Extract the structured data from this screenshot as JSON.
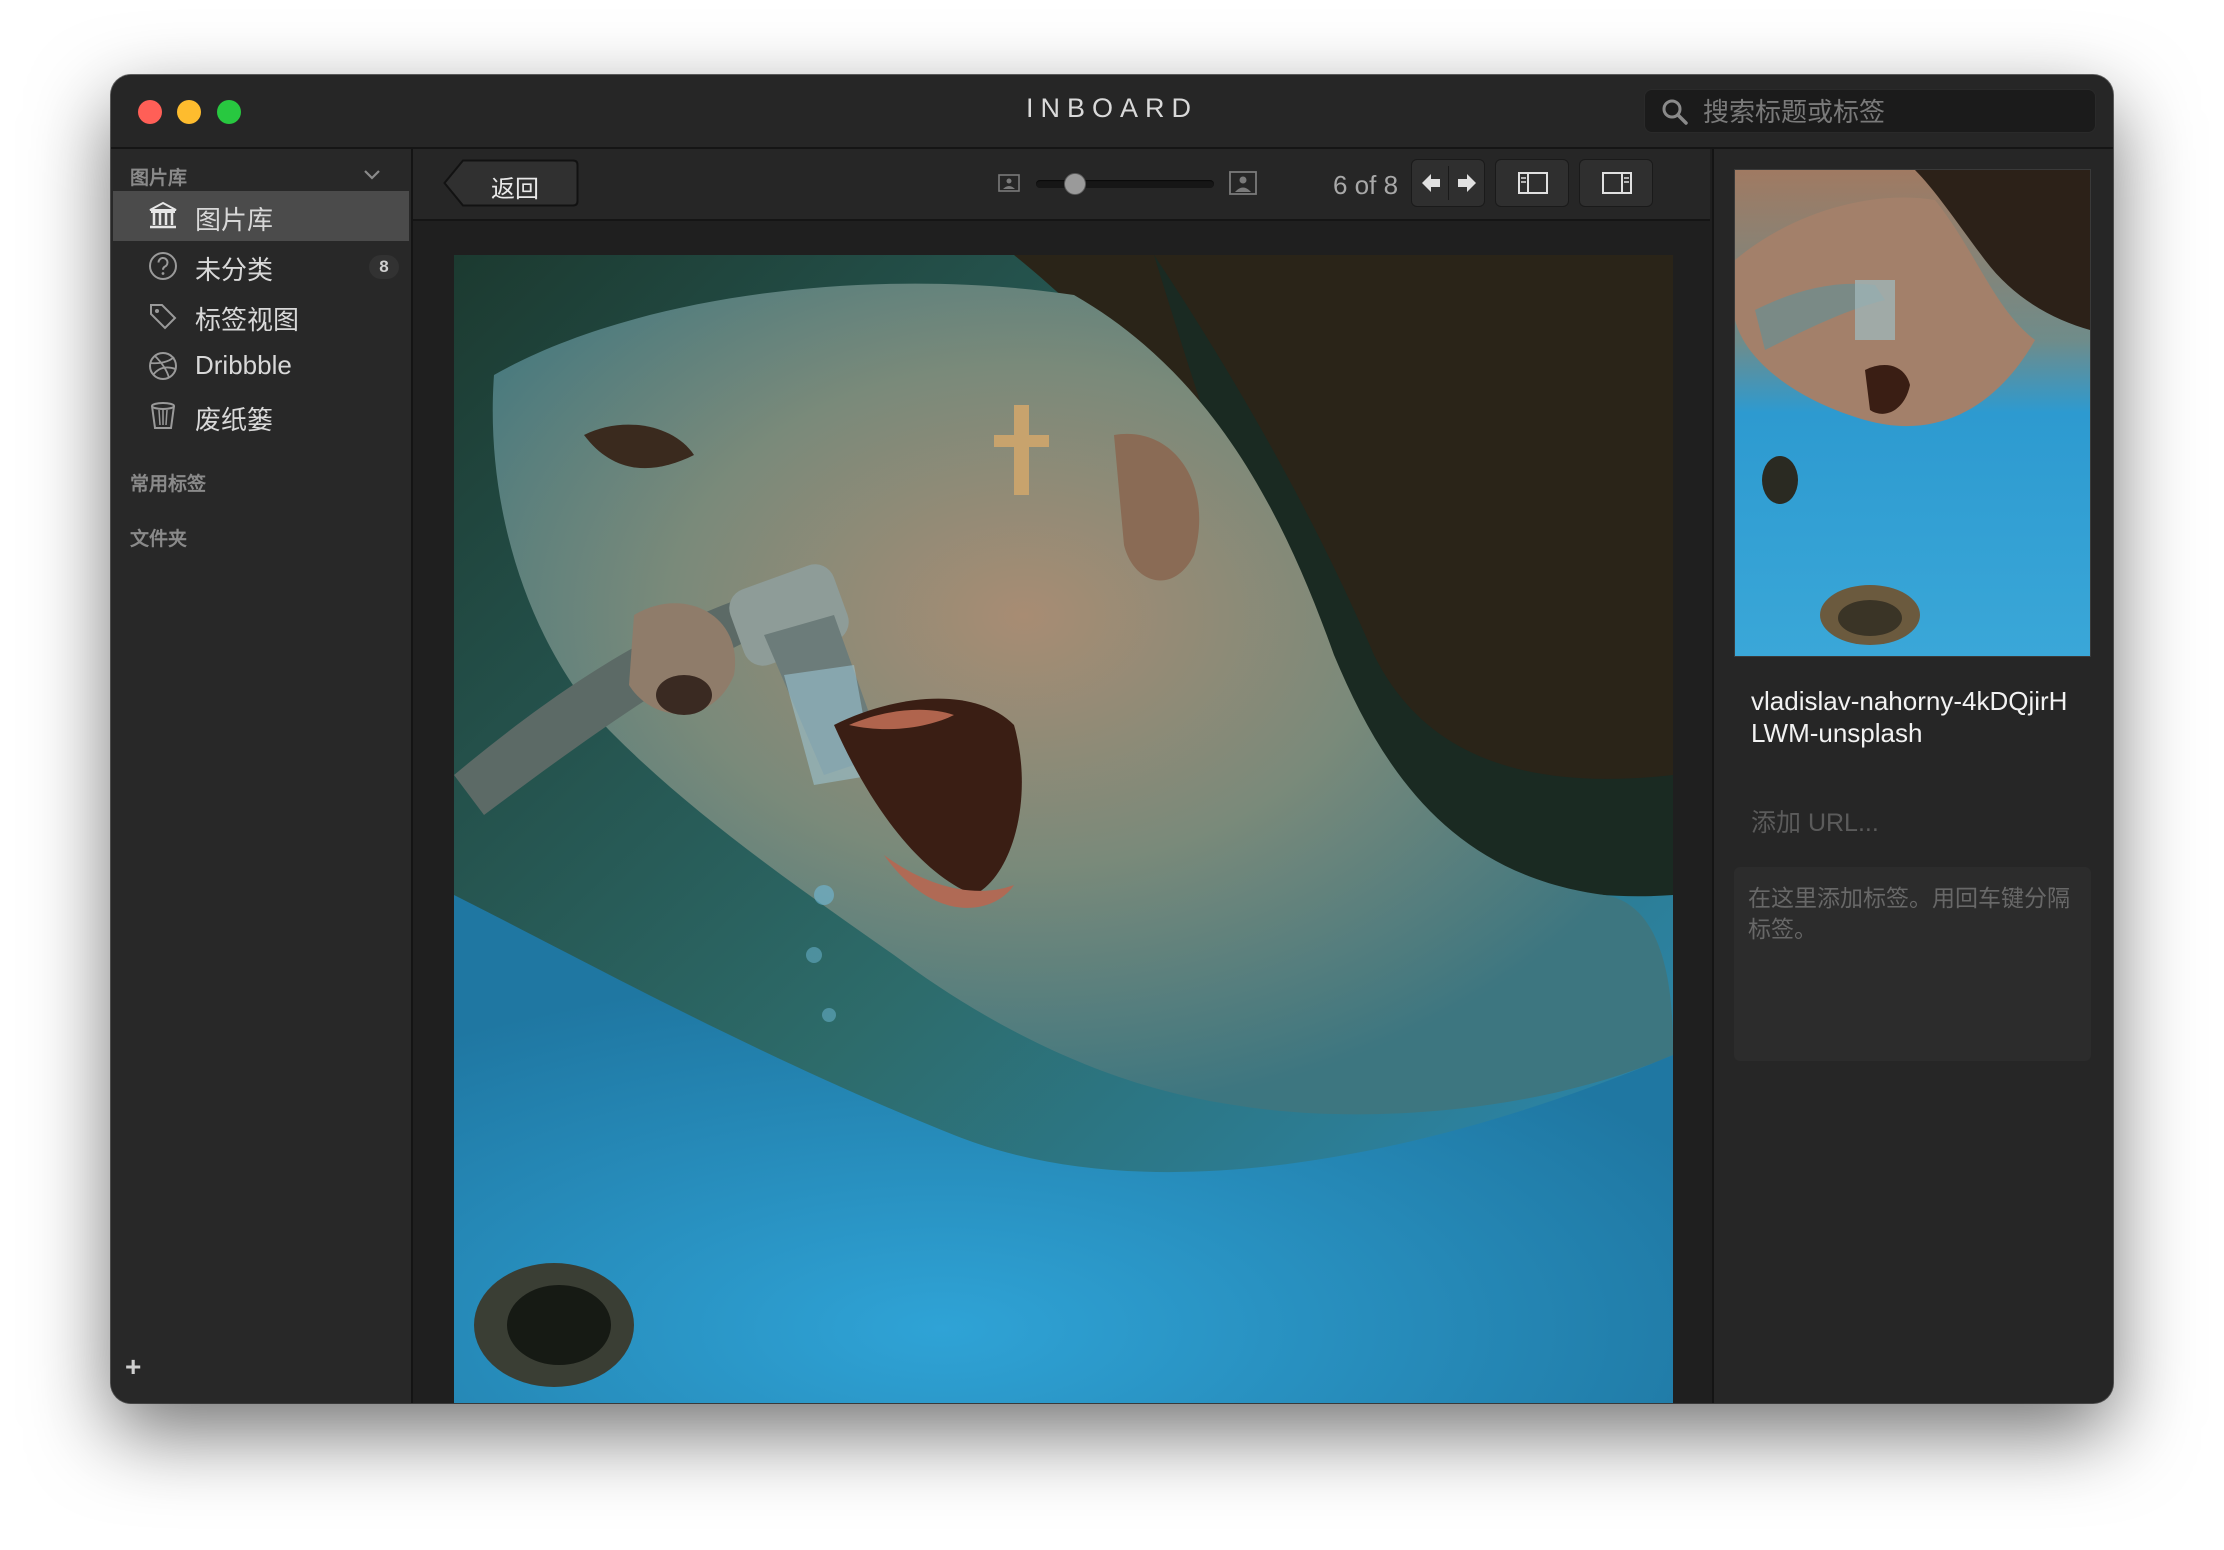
{
  "window": {
    "title": "INBOARD",
    "search_placeholder": "搜索标题或标签"
  },
  "sidebar": {
    "library_header": "图片库",
    "items": [
      {
        "label": "图片库",
        "icon": "library-icon",
        "active": true
      },
      {
        "label": "未分类",
        "icon": "question-circle-icon",
        "badge": "8"
      },
      {
        "label": "标签视图",
        "icon": "tag-icon"
      },
      {
        "label": "Dribbble",
        "icon": "dribbble-icon"
      },
      {
        "label": "废纸篓",
        "icon": "trash-icon"
      }
    ],
    "favorite_tags_header": "常用标签",
    "folders_header": "文件夹",
    "add_label": "+"
  },
  "toolbar": {
    "back_label": "返回",
    "zoom_level": 0.18,
    "page_counter": "6 of 8"
  },
  "image": {
    "description_icon": "photo-woman-drinking-from-faucet"
  },
  "inspector": {
    "filename": "vladislav-nahorny-4kDQjirHLWM-unsplash",
    "url_placeholder": "添加 URL...",
    "tags_placeholder": "在这里添加标签。用回车键分隔标签。"
  },
  "colors": {
    "window_bg": "#1f1f1f",
    "sidebar_active": "#4b4b4b",
    "close": "#ff5f57",
    "minimize": "#febc2e",
    "zoom": "#28c840"
  }
}
